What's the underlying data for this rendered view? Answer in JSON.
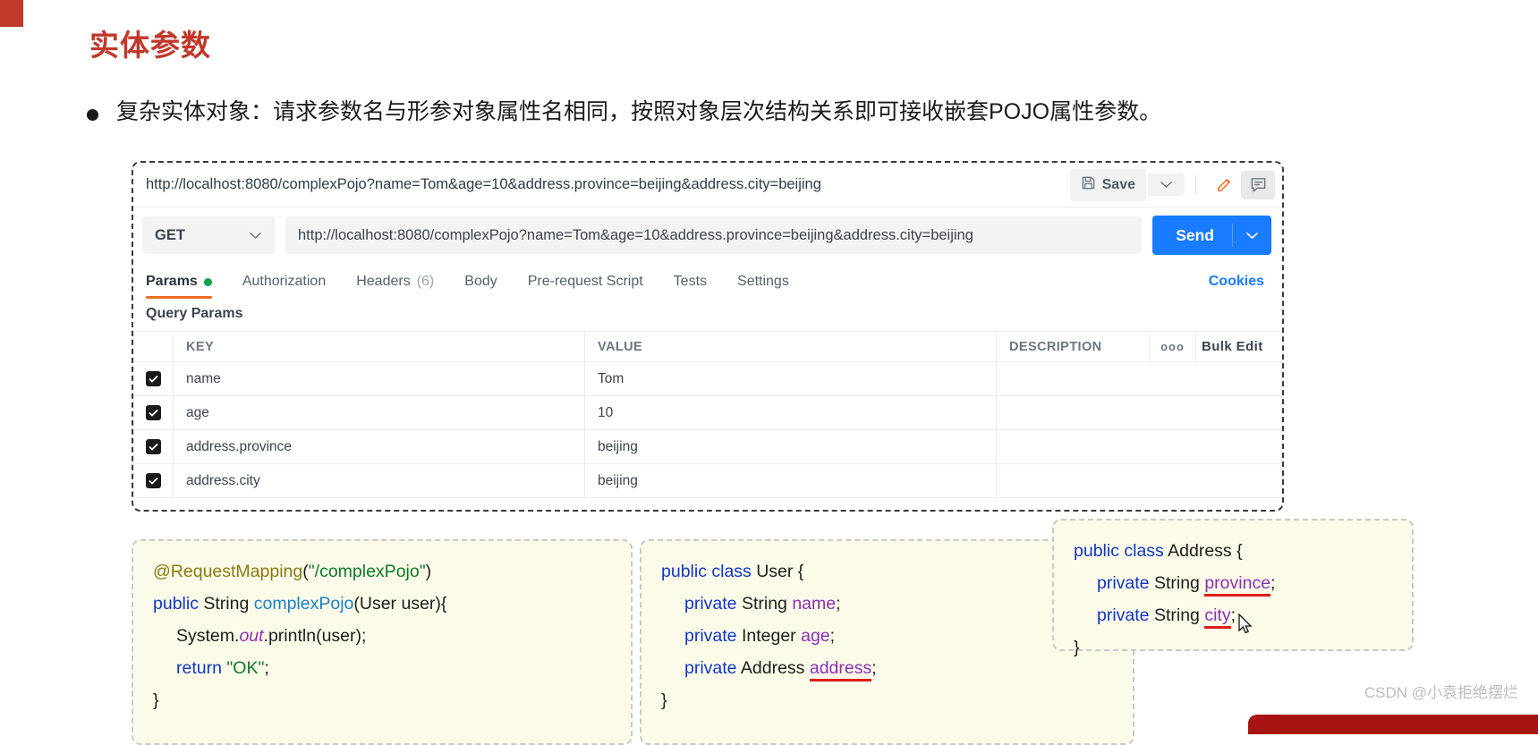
{
  "slide": {
    "title": "实体参数",
    "bullet": "复杂实体对象：请求参数名与形参对象属性名相同，按照对象层次结构关系即可接收嵌套POJO属性参数。"
  },
  "postman": {
    "tab_title": "http://localhost:8080/complexPojo?name=Tom&age=10&address.province=beijing&address.city=beijing",
    "save_label": "Save",
    "save_caret": "⌄",
    "edit_icon": "pencil-icon",
    "comment_icon": "comment-icon",
    "method": "GET",
    "method_caret": "⌄",
    "url": "http://localhost:8080/complexPojo?name=Tom&age=10&address.province=beijing&address.city=beijing",
    "send_label": "Send",
    "send_caret": "⌄",
    "tabs": [
      {
        "label": "Params",
        "dot": true,
        "active": true
      },
      {
        "label": "Authorization",
        "active": false
      },
      {
        "label": "Headers",
        "count": "(6)",
        "active": false
      },
      {
        "label": "Body",
        "active": false
      },
      {
        "label": "Pre-request Script",
        "active": false
      },
      {
        "label": "Tests",
        "active": false
      },
      {
        "label": "Settings",
        "active": false
      }
    ],
    "cookies_label": "Cookies",
    "query_params_label": "Query Params",
    "table": {
      "headers": {
        "key": "KEY",
        "value": "VALUE",
        "description": "DESCRIPTION",
        "dots": "ooo",
        "bulk_edit": "Bulk Edit"
      },
      "rows": [
        {
          "checked": true,
          "key": "name",
          "value": "Tom",
          "description": ""
        },
        {
          "checked": true,
          "key": "age",
          "value": "10",
          "description": ""
        },
        {
          "checked": true,
          "key": "address.province",
          "value": "beijing",
          "description": ""
        },
        {
          "checked": true,
          "key": "address.city",
          "value": "beijing",
          "description": ""
        }
      ]
    },
    "accent_color": "#ef6c1f",
    "send_color": "#197bff",
    "link_color": "#197bff",
    "dot_color": "#0fa44a"
  },
  "code": {
    "controller": {
      "l1_anno": "@RequestMapping",
      "l1_paren_open": "(",
      "l1_str": "\"/complexPojo\"",
      "l1_paren_close": ")",
      "l2_kw": "public",
      "l2_type": "String",
      "l2_method": "complexPojo",
      "l2_args": "(User user){",
      "l3_a": "System.",
      "l3_static": "out",
      "l3_b": ".println(user);",
      "l4_kw": "return",
      "l4_str": "\"OK\"",
      "l4_semi": ";",
      "l5": "}"
    },
    "user": {
      "l1_kw": "public class",
      "l1_name": "User {",
      "l2_kw": "private",
      "l2_type": "String",
      "l2_field": "name",
      "l2_semi": ";",
      "l3_kw": "private",
      "l3_type": "Integer",
      "l3_field": "age",
      "l3_semi": ";",
      "l4_kw": "private",
      "l4_type": "Address",
      "l4_field": "address",
      "l4_semi": ";",
      "l5": "}"
    },
    "address": {
      "l1_kw": "public class",
      "l1_name": "Address {",
      "l2_kw": "private",
      "l2_type": "String",
      "l2_field": "province",
      "l2_semi": ";",
      "l3_kw": "private",
      "l3_type": "String",
      "l3_field": "city",
      "l3_semi": ";",
      "l4": "}"
    }
  },
  "watermark": "CSDN @小袁拒绝摆烂"
}
